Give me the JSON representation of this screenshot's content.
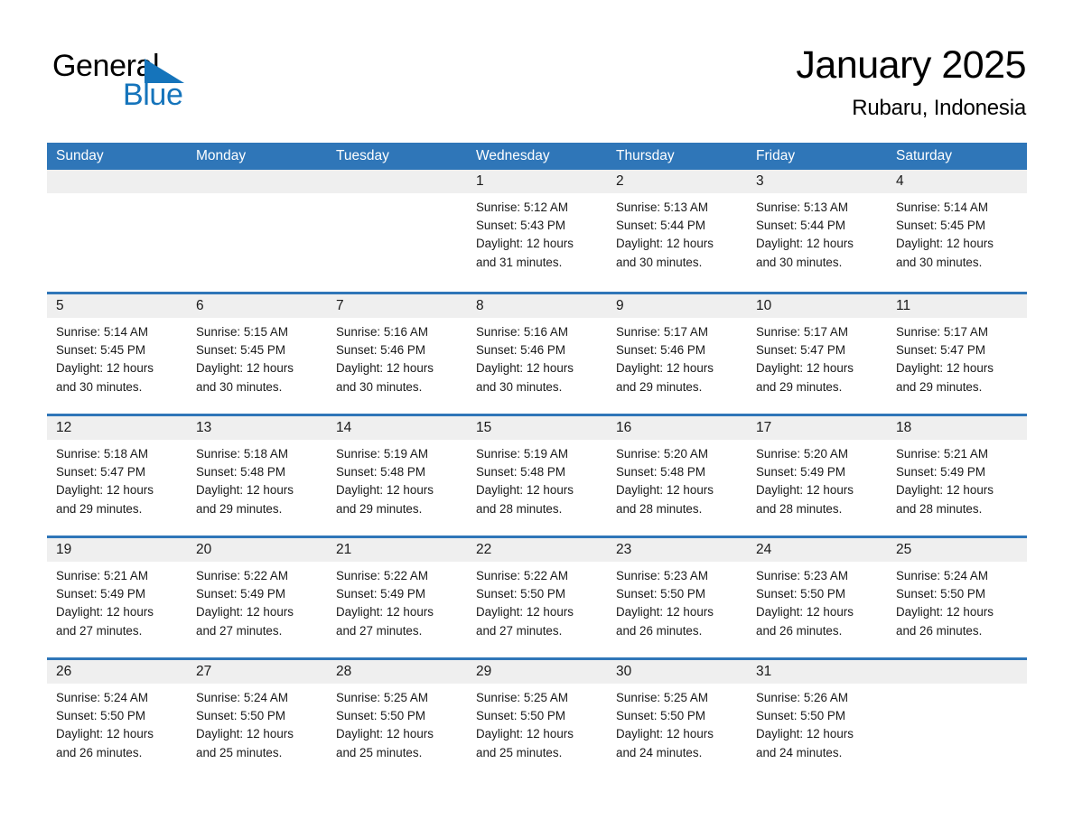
{
  "logo": {
    "word_one": "General",
    "word_two": "Blue",
    "triangle_color": "#1574BB",
    "text_color": "#000000"
  },
  "header": {
    "title": "January 2025",
    "location": "Rubaru, Indonesia"
  },
  "theme": {
    "header_blue": "#2F76B8",
    "day_band_gray": "#EFEFEF",
    "page_background": "#FFFFFF",
    "text_color": "#1A1A1A"
  },
  "weekday_headers": [
    "Sunday",
    "Monday",
    "Tuesday",
    "Wednesday",
    "Thursday",
    "Friday",
    "Saturday"
  ],
  "labels": {
    "sunrise_prefix": "Sunrise:",
    "sunset_prefix": "Sunset:",
    "daylight_prefix": "Daylight:"
  },
  "weeks": [
    [
      {
        "day": "",
        "empty": true
      },
      {
        "day": "",
        "empty": true
      },
      {
        "day": "",
        "empty": true
      },
      {
        "day": "1",
        "sunrise": "Sunrise: 5:12 AM",
        "sunset": "Sunset: 5:43 PM",
        "daylight_line1": "Daylight: 12 hours",
        "daylight_line2": "and 31 minutes."
      },
      {
        "day": "2",
        "sunrise": "Sunrise: 5:13 AM",
        "sunset": "Sunset: 5:44 PM",
        "daylight_line1": "Daylight: 12 hours",
        "daylight_line2": "and 30 minutes."
      },
      {
        "day": "3",
        "sunrise": "Sunrise: 5:13 AM",
        "sunset": "Sunset: 5:44 PM",
        "daylight_line1": "Daylight: 12 hours",
        "daylight_line2": "and 30 minutes."
      },
      {
        "day": "4",
        "sunrise": "Sunrise: 5:14 AM",
        "sunset": "Sunset: 5:45 PM",
        "daylight_line1": "Daylight: 12 hours",
        "daylight_line2": "and 30 minutes."
      }
    ],
    [
      {
        "day": "5",
        "sunrise": "Sunrise: 5:14 AM",
        "sunset": "Sunset: 5:45 PM",
        "daylight_line1": "Daylight: 12 hours",
        "daylight_line2": "and 30 minutes."
      },
      {
        "day": "6",
        "sunrise": "Sunrise: 5:15 AM",
        "sunset": "Sunset: 5:45 PM",
        "daylight_line1": "Daylight: 12 hours",
        "daylight_line2": "and 30 minutes."
      },
      {
        "day": "7",
        "sunrise": "Sunrise: 5:16 AM",
        "sunset": "Sunset: 5:46 PM",
        "daylight_line1": "Daylight: 12 hours",
        "daylight_line2": "and 30 minutes."
      },
      {
        "day": "8",
        "sunrise": "Sunrise: 5:16 AM",
        "sunset": "Sunset: 5:46 PM",
        "daylight_line1": "Daylight: 12 hours",
        "daylight_line2": "and 30 minutes."
      },
      {
        "day": "9",
        "sunrise": "Sunrise: 5:17 AM",
        "sunset": "Sunset: 5:46 PM",
        "daylight_line1": "Daylight: 12 hours",
        "daylight_line2": "and 29 minutes."
      },
      {
        "day": "10",
        "sunrise": "Sunrise: 5:17 AM",
        "sunset": "Sunset: 5:47 PM",
        "daylight_line1": "Daylight: 12 hours",
        "daylight_line2": "and 29 minutes."
      },
      {
        "day": "11",
        "sunrise": "Sunrise: 5:17 AM",
        "sunset": "Sunset: 5:47 PM",
        "daylight_line1": "Daylight: 12 hours",
        "daylight_line2": "and 29 minutes."
      }
    ],
    [
      {
        "day": "12",
        "sunrise": "Sunrise: 5:18 AM",
        "sunset": "Sunset: 5:47 PM",
        "daylight_line1": "Daylight: 12 hours",
        "daylight_line2": "and 29 minutes."
      },
      {
        "day": "13",
        "sunrise": "Sunrise: 5:18 AM",
        "sunset": "Sunset: 5:48 PM",
        "daylight_line1": "Daylight: 12 hours",
        "daylight_line2": "and 29 minutes."
      },
      {
        "day": "14",
        "sunrise": "Sunrise: 5:19 AM",
        "sunset": "Sunset: 5:48 PM",
        "daylight_line1": "Daylight: 12 hours",
        "daylight_line2": "and 29 minutes."
      },
      {
        "day": "15",
        "sunrise": "Sunrise: 5:19 AM",
        "sunset": "Sunset: 5:48 PM",
        "daylight_line1": "Daylight: 12 hours",
        "daylight_line2": "and 28 minutes."
      },
      {
        "day": "16",
        "sunrise": "Sunrise: 5:20 AM",
        "sunset": "Sunset: 5:48 PM",
        "daylight_line1": "Daylight: 12 hours",
        "daylight_line2": "and 28 minutes."
      },
      {
        "day": "17",
        "sunrise": "Sunrise: 5:20 AM",
        "sunset": "Sunset: 5:49 PM",
        "daylight_line1": "Daylight: 12 hours",
        "daylight_line2": "and 28 minutes."
      },
      {
        "day": "18",
        "sunrise": "Sunrise: 5:21 AM",
        "sunset": "Sunset: 5:49 PM",
        "daylight_line1": "Daylight: 12 hours",
        "daylight_line2": "and 28 minutes."
      }
    ],
    [
      {
        "day": "19",
        "sunrise": "Sunrise: 5:21 AM",
        "sunset": "Sunset: 5:49 PM",
        "daylight_line1": "Daylight: 12 hours",
        "daylight_line2": "and 27 minutes."
      },
      {
        "day": "20",
        "sunrise": "Sunrise: 5:22 AM",
        "sunset": "Sunset: 5:49 PM",
        "daylight_line1": "Daylight: 12 hours",
        "daylight_line2": "and 27 minutes."
      },
      {
        "day": "21",
        "sunrise": "Sunrise: 5:22 AM",
        "sunset": "Sunset: 5:49 PM",
        "daylight_line1": "Daylight: 12 hours",
        "daylight_line2": "and 27 minutes."
      },
      {
        "day": "22",
        "sunrise": "Sunrise: 5:22 AM",
        "sunset": "Sunset: 5:50 PM",
        "daylight_line1": "Daylight: 12 hours",
        "daylight_line2": "and 27 minutes."
      },
      {
        "day": "23",
        "sunrise": "Sunrise: 5:23 AM",
        "sunset": "Sunset: 5:50 PM",
        "daylight_line1": "Daylight: 12 hours",
        "daylight_line2": "and 26 minutes."
      },
      {
        "day": "24",
        "sunrise": "Sunrise: 5:23 AM",
        "sunset": "Sunset: 5:50 PM",
        "daylight_line1": "Daylight: 12 hours",
        "daylight_line2": "and 26 minutes."
      },
      {
        "day": "25",
        "sunrise": "Sunrise: 5:24 AM",
        "sunset": "Sunset: 5:50 PM",
        "daylight_line1": "Daylight: 12 hours",
        "daylight_line2": "and 26 minutes."
      }
    ],
    [
      {
        "day": "26",
        "sunrise": "Sunrise: 5:24 AM",
        "sunset": "Sunset: 5:50 PM",
        "daylight_line1": "Daylight: 12 hours",
        "daylight_line2": "and 26 minutes."
      },
      {
        "day": "27",
        "sunrise": "Sunrise: 5:24 AM",
        "sunset": "Sunset: 5:50 PM",
        "daylight_line1": "Daylight: 12 hours",
        "daylight_line2": "and 25 minutes."
      },
      {
        "day": "28",
        "sunrise": "Sunrise: 5:25 AM",
        "sunset": "Sunset: 5:50 PM",
        "daylight_line1": "Daylight: 12 hours",
        "daylight_line2": "and 25 minutes."
      },
      {
        "day": "29",
        "sunrise": "Sunrise: 5:25 AM",
        "sunset": "Sunset: 5:50 PM",
        "daylight_line1": "Daylight: 12 hours",
        "daylight_line2": "and 25 minutes."
      },
      {
        "day": "30",
        "sunrise": "Sunrise: 5:25 AM",
        "sunset": "Sunset: 5:50 PM",
        "daylight_line1": "Daylight: 12 hours",
        "daylight_line2": "and 24 minutes."
      },
      {
        "day": "31",
        "sunrise": "Sunrise: 5:26 AM",
        "sunset": "Sunset: 5:50 PM",
        "daylight_line1": "Daylight: 12 hours",
        "daylight_line2": "and 24 minutes."
      },
      {
        "day": "",
        "empty": true
      }
    ]
  ]
}
